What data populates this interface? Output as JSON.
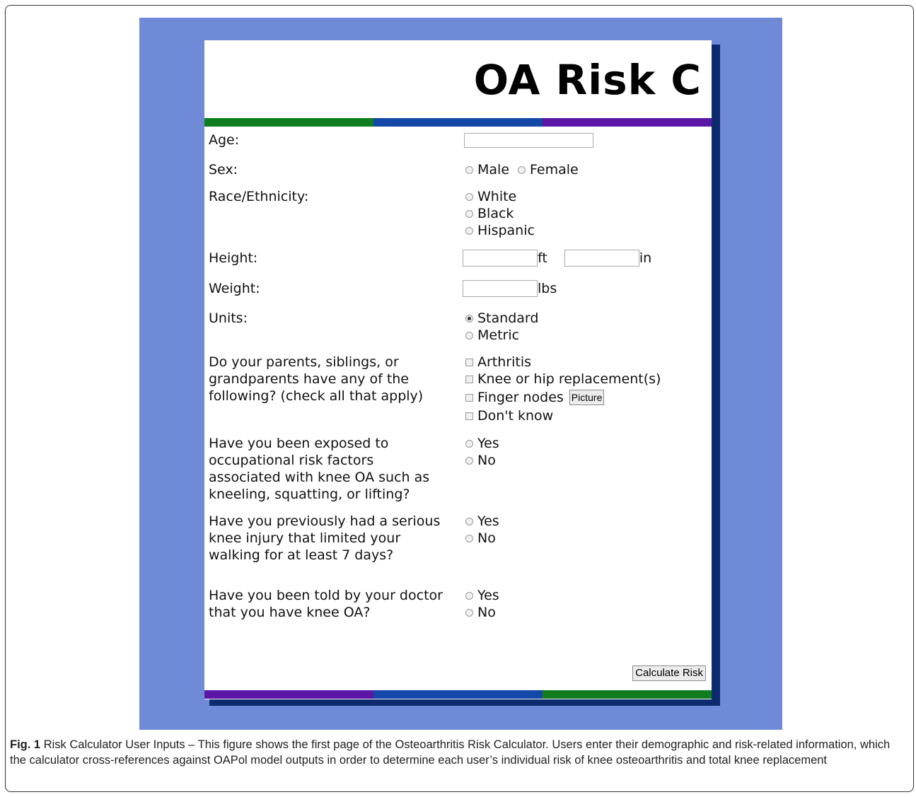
{
  "app": {
    "title": "OA Risk C",
    "colors": {
      "green": "#0f7c1e",
      "blue": "#1448a8",
      "purple": "#5b16a8",
      "background": "#6f8bd8"
    }
  },
  "form": {
    "age": {
      "label": "Age:",
      "value": ""
    },
    "sex": {
      "label": "Sex:",
      "options": [
        "Male",
        "Female"
      ]
    },
    "race": {
      "label": "Race/Ethnicity:",
      "options": [
        "White",
        "Black",
        "Hispanic"
      ]
    },
    "height": {
      "label": "Height:",
      "ft_unit": "ft",
      "in_unit": "in",
      "ft_value": "",
      "in_value": ""
    },
    "weight": {
      "label": "Weight:",
      "unit": "lbs",
      "value": ""
    },
    "units": {
      "label": "Units:",
      "options": [
        "Standard",
        "Metric"
      ],
      "selected": "Standard"
    },
    "family": {
      "label_lines": [
        "Do your parents, siblings, or",
        "grandparents have any of the",
        "following? (check all that apply)"
      ],
      "options": [
        "Arthritis",
        "Knee or hip replacement(s)",
        "Finger nodes",
        "Don't know"
      ],
      "picture_button": "Picture"
    },
    "occupational": {
      "label_lines": [
        "Have you been exposed to",
        "occupational risk factors",
        "associated with knee OA such as",
        "kneeling, squatting, or lifting?"
      ],
      "options": [
        "Yes",
        "No"
      ]
    },
    "injury": {
      "label_lines": [
        "Have you previously had a serious",
        "knee injury that limited your",
        "walking for at least 7 days?"
      ],
      "options": [
        "Yes",
        "No"
      ]
    },
    "doctor": {
      "label_lines": [
        "Have you been told by your doctor",
        "that you have knee OA?"
      ],
      "options": [
        "Yes",
        "No"
      ]
    },
    "calculate_button": "Calculate Risk"
  },
  "caption": {
    "label": "Fig. 1",
    "text": "Risk Calculator User Inputs – This figure shows the first page of the Osteoarthritis Risk Calculator. Users enter their demographic and risk-related information, which the calculator cross-references against OAPol model outputs in order to determine each user’s individual risk of knee osteoarthritis and total knee replacement"
  }
}
